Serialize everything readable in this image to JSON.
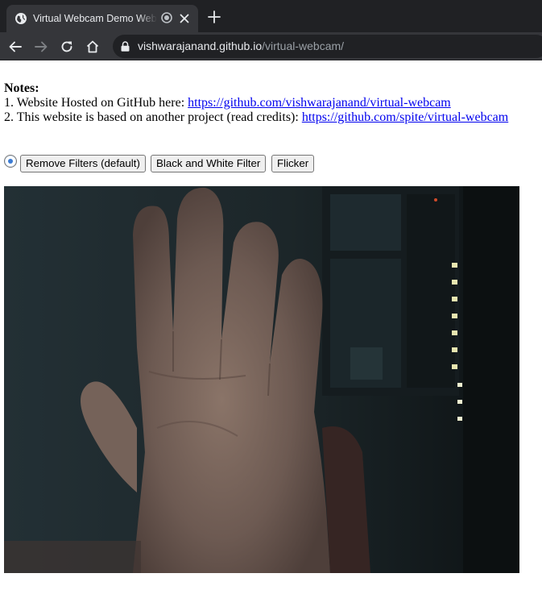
{
  "browser": {
    "tab": {
      "title": "Virtual Webcam Demo Website"
    },
    "url": {
      "host": "vishwarajanand.github.io",
      "path": "/virtual-webcam/"
    },
    "icons": {
      "favicon": "globe-icon",
      "recording": "recording-indicator-icon",
      "close": "close-icon",
      "new_tab": "plus-icon",
      "back": "back-arrow-icon",
      "forward": "forward-arrow-icon",
      "reload": "reload-icon",
      "home": "home-icon",
      "lock": "lock-icon"
    }
  },
  "page": {
    "notes_heading": "Notes:",
    "notes": [
      {
        "prefix": "1. Website Hosted on GitHub here: ",
        "link": "https://github.com/vishwarajanand/virtual-webcam"
      },
      {
        "prefix": "2. This website is based on another project (read credits): ",
        "link": "https://github.com/spite/virtual-webcam"
      }
    ],
    "buttons": {
      "remove_filters": "Remove Filters (default)",
      "black_white": "Black and White Filter",
      "flicker": "Flicker"
    },
    "radio_selected": true,
    "video": {
      "description_icon": "webcam-video-feed"
    }
  },
  "colors": {
    "link": "#0000ee",
    "chrome_dark": "#202124",
    "chrome_tab": "#35363a",
    "radio_accent": "#3b7bd3"
  }
}
